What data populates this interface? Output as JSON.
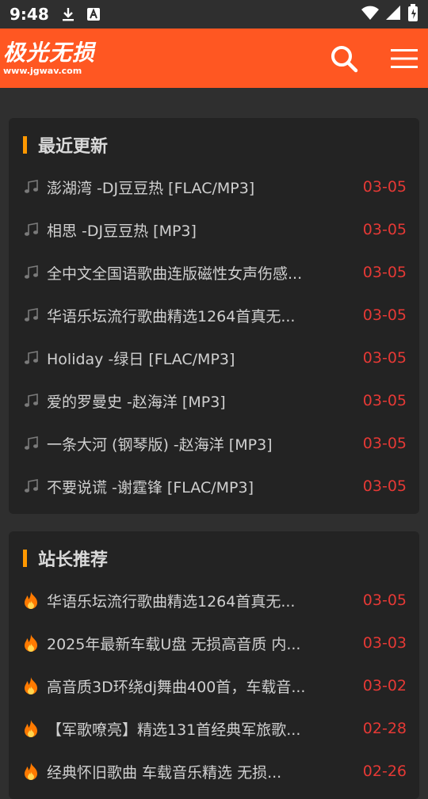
{
  "status": {
    "time": "9:48"
  },
  "header": {
    "logo_main": "极光无损",
    "logo_sub": "www.jgwav.com"
  },
  "sections": [
    {
      "title": "最近更新",
      "items": [
        {
          "title": "澎湖湾 -DJ豆豆热 [FLAC/MP3]",
          "date": "03-05"
        },
        {
          "title": "相思 -DJ豆豆热 [MP3]",
          "date": "03-05"
        },
        {
          "title": "全中文全国语歌曲连版磁性女声伤感...",
          "date": "03-05"
        },
        {
          "title": "华语乐坛流行歌曲精选1264首真无...",
          "date": "03-05"
        },
        {
          "title": "Holiday -绿日 [FLAC/MP3]",
          "date": "03-05"
        },
        {
          "title": "爱的罗曼史 -赵海洋 [MP3]",
          "date": "03-05"
        },
        {
          "title": "一条大河 (钢琴版) -赵海洋 [MP3]",
          "date": "03-05"
        },
        {
          "title": "不要说谎 -谢霆锋 [FLAC/MP3]",
          "date": "03-05"
        }
      ]
    },
    {
      "title": "站长推荐",
      "items": [
        {
          "title": "华语乐坛流行歌曲精选1264首真无...",
          "date": "03-05"
        },
        {
          "title": "2025年最新车载U盘 无损高音质 内...",
          "date": "03-03"
        },
        {
          "title": "高音质3D环绕dj舞曲400首，车载音...",
          "date": "03-02"
        },
        {
          "title": "【军歌嘹亮】精选131首经典军旅歌...",
          "date": "02-28"
        },
        {
          "title": "经典怀旧歌曲 车载音乐精选 无损...",
          "date": "02-26"
        }
      ]
    }
  ],
  "colors": {
    "header": "#ff5722",
    "accent_bar": "#ff9800",
    "date": "#e53935",
    "background": "#2f2f2f",
    "card": "#232323"
  }
}
